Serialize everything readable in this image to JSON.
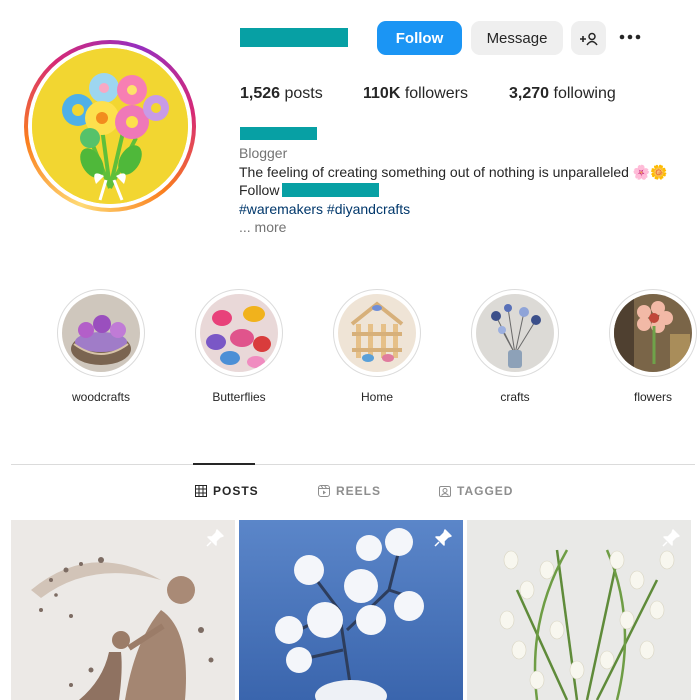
{
  "profile": {
    "follow_label": "Follow",
    "message_label": "Message",
    "add_user_icon": "+person-icon",
    "more_icon": "more-horizontal-icon",
    "stats": {
      "posts_value": "1,526",
      "posts_label": " posts",
      "followers_value": "110K",
      "followers_label": " followers",
      "following_value": "3,270",
      "following_label": " following"
    },
    "bio": {
      "category": "Blogger",
      "text": "The feeling of creating something out of nothing is unparalleled 🌸🌼",
      "follow_prefix": "Follow",
      "hashtags": "#waremakers #diyandcrafts",
      "more": "... more"
    },
    "redacted_color": "#07a0a4"
  },
  "highlights": [
    {
      "label": "woodcrafts"
    },
    {
      "label": "Butterflies"
    },
    {
      "label": "Home"
    },
    {
      "label": "crafts"
    },
    {
      "label": "flowers"
    }
  ],
  "tabs": [
    {
      "label": "POSTS",
      "icon": "grid-icon",
      "active": true
    },
    {
      "label": "REELS",
      "icon": "reels-icon",
      "active": false
    },
    {
      "label": "TAGGED",
      "icon": "tagged-icon",
      "active": false
    }
  ],
  "posts": [
    {
      "pinned": true,
      "subject": "pebble art mother and child"
    },
    {
      "pinned": true,
      "subject": "white paper roses in vase"
    },
    {
      "pinned": true,
      "subject": "lily of the valley paper flowers"
    }
  ],
  "colors": {
    "accent_blue": "#1b95f4",
    "button_gray": "#efefef",
    "text": "#262626",
    "muted": "#737373",
    "hashtag": "#00376b"
  }
}
